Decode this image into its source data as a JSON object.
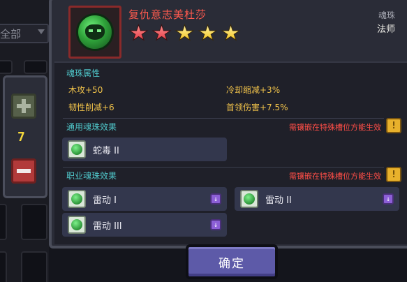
{
  "filter": {
    "label": "全部"
  },
  "quantity": {
    "value": "7"
  },
  "orb": {
    "name": "复仇意志美杜莎",
    "stars": [
      {
        "color": "red",
        "icon": "star-red-icon"
      },
      {
        "color": "red",
        "icon": "star-red-icon"
      },
      {
        "color": "gold",
        "icon": "star-gold-icon"
      },
      {
        "color": "gold",
        "icon": "star-gold-icon"
      },
      {
        "color": "gold",
        "icon": "star-gold-icon"
      }
    ],
    "type_label": "魂珠",
    "class_label": "法师"
  },
  "attributes": {
    "title": "魂珠属性",
    "items": [
      "木攻+50",
      "冷却缩减+3%",
      "韧性削减+6",
      "首领伤害+7.5%"
    ]
  },
  "general_effects": {
    "title": "通用魂珠效果",
    "warning": "需镶嵌在特殊槽位方能生效",
    "badge": "!",
    "items": [
      {
        "label": "蛇毒 II"
      }
    ]
  },
  "class_effects": {
    "title": "职业魂珠效果",
    "warning": "需镶嵌在特殊槽位方能生效",
    "badge": "!",
    "items": [
      {
        "label": "雷动 I",
        "tag": "↓"
      },
      {
        "label": "雷动 II",
        "tag": "↓"
      },
      {
        "label": "雷动 III",
        "tag": "↓"
      }
    ]
  },
  "confirm_label": "确定",
  "colors": {
    "name": "#ff5a4e",
    "section_title": "#4fc6c9",
    "attribute": "#f0c24a",
    "warning": "#ff4e47",
    "confirm_button": "#5d5aa8"
  }
}
